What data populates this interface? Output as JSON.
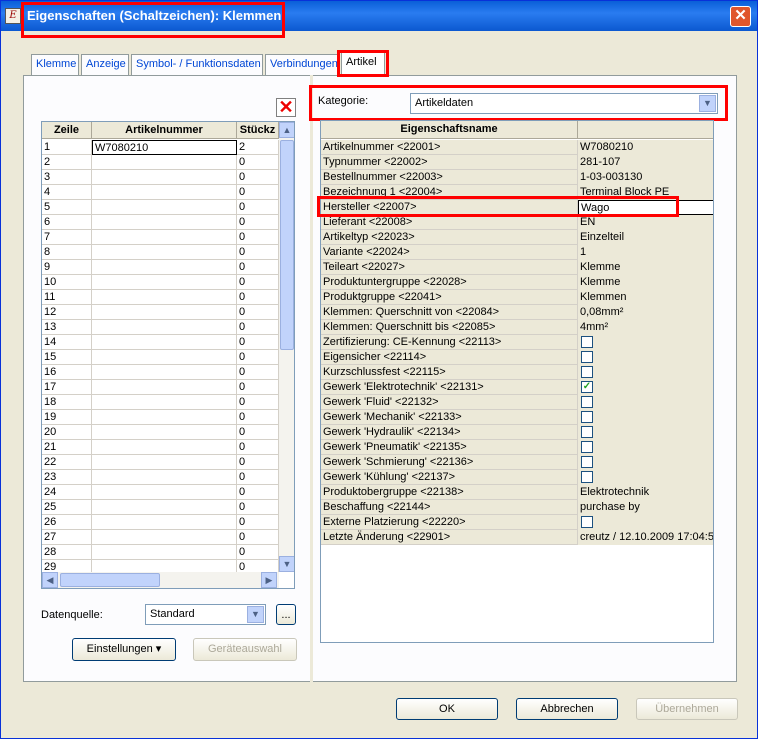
{
  "window": {
    "title": "Eigenschaften (Schaltzeichen): Klemmen",
    "app_icon": "app-icon",
    "close_glyph": "✕"
  },
  "tabs": [
    {
      "label": "Klemme"
    },
    {
      "label": "Anzeige"
    },
    {
      "label": "Symbol- / Funktionsdaten"
    },
    {
      "label": "Verbindungen"
    },
    {
      "label": "Artikel",
      "active": true
    }
  ],
  "left": {
    "delete_glyph": "✕",
    "columns": [
      "Zeile",
      "Artikelnummer",
      "Stückz"
    ],
    "rows": [
      [
        "1",
        "W7080210",
        "2"
      ],
      [
        "2",
        "",
        "0"
      ],
      [
        "3",
        "",
        "0"
      ],
      [
        "4",
        "",
        "0"
      ],
      [
        "5",
        "",
        "0"
      ],
      [
        "6",
        "",
        "0"
      ],
      [
        "7",
        "",
        "0"
      ],
      [
        "8",
        "",
        "0"
      ],
      [
        "9",
        "",
        "0"
      ],
      [
        "10",
        "",
        "0"
      ],
      [
        "11",
        "",
        "0"
      ],
      [
        "12",
        "",
        "0"
      ],
      [
        "13",
        "",
        "0"
      ],
      [
        "14",
        "",
        "0"
      ],
      [
        "15",
        "",
        "0"
      ],
      [
        "16",
        "",
        "0"
      ],
      [
        "17",
        "",
        "0"
      ],
      [
        "18",
        "",
        "0"
      ],
      [
        "19",
        "",
        "0"
      ],
      [
        "20",
        "",
        "0"
      ],
      [
        "21",
        "",
        "0"
      ],
      [
        "22",
        "",
        "0"
      ],
      [
        "23",
        "",
        "0"
      ],
      [
        "24",
        "",
        "0"
      ],
      [
        "25",
        "",
        "0"
      ],
      [
        "26",
        "",
        "0"
      ],
      [
        "27",
        "",
        "0"
      ],
      [
        "28",
        "",
        "0"
      ],
      [
        "29",
        "",
        "0"
      ]
    ],
    "datenquelle_label": "Datenquelle:",
    "datenquelle_value": "Standard",
    "browse_label": "...",
    "einstellungen_label": "Einstellungen",
    "geraeteauswahl_label": "Geräteauswahl"
  },
  "right": {
    "kategorie_label": "Kategorie:",
    "kategorie_value": "Artikeldaten",
    "columns": [
      "Eigenschaftsname",
      ""
    ],
    "rows": [
      {
        "name": "Artikelnummer <22001>",
        "value": "W7080210"
      },
      {
        "name": "Typnummer <22002>",
        "value": "281-107"
      },
      {
        "name": "Bestellnummer <22003>",
        "value": "1-03-003130"
      },
      {
        "name": "Bezeichnung 1 <22004>",
        "value": "Terminal Block PE"
      },
      {
        "name": "Hersteller <22007>",
        "value": "Wago",
        "selected": true
      },
      {
        "name": "Lieferant <22008>",
        "value": "EN"
      },
      {
        "name": "Artikeltyp <22023>",
        "value": "Einzelteil"
      },
      {
        "name": "Variante <22024>",
        "value": "1"
      },
      {
        "name": "Teileart <22027>",
        "value": "Klemme"
      },
      {
        "name": "Produktuntergruppe <22028>",
        "value": "Klemme"
      },
      {
        "name": "Produktgruppe <22041>",
        "value": "Klemmen"
      },
      {
        "name": "Klemmen: Querschnitt von <22084>",
        "value": "0,08mm²"
      },
      {
        "name": "Klemmen: Querschnitt bis <22085>",
        "value": "4mm²"
      },
      {
        "name": "Zertifizierung: CE-Kennung <22113>",
        "check": false
      },
      {
        "name": "Eigensicher <22114>",
        "check": false
      },
      {
        "name": "Kurzschlussfest <22115>",
        "check": false
      },
      {
        "name": "Gewerk 'Elektrotechnik' <22131>",
        "check": true
      },
      {
        "name": "Gewerk 'Fluid' <22132>",
        "check": false
      },
      {
        "name": "Gewerk 'Mechanik' <22133>",
        "check": false
      },
      {
        "name": "Gewerk 'Hydraulik' <22134>",
        "check": false
      },
      {
        "name": "Gewerk 'Pneumatik' <22135>",
        "check": false
      },
      {
        "name": "Gewerk 'Schmierung' <22136>",
        "check": false
      },
      {
        "name": "Gewerk 'Kühlung' <22137>",
        "check": false
      },
      {
        "name": "Produktobergruppe <22138>",
        "value": "Elektrotechnik"
      },
      {
        "name": "Beschaffung <22144>",
        "value": "purchase by"
      },
      {
        "name": "Externe Platzierung <22220>",
        "check": false
      },
      {
        "name": "Letzte Änderung <22901>",
        "value": "creutz / 12.10.2009 17:04:5"
      }
    ],
    "check_glyph": "✓"
  },
  "footer": {
    "ok_label": "OK",
    "cancel_label": "Abbrechen",
    "apply_label": "Übernehmen"
  },
  "colors": {
    "highlight": "#ff0000",
    "title_bar": "#0a5fd8",
    "dialog_bg": "#ece9d8"
  }
}
